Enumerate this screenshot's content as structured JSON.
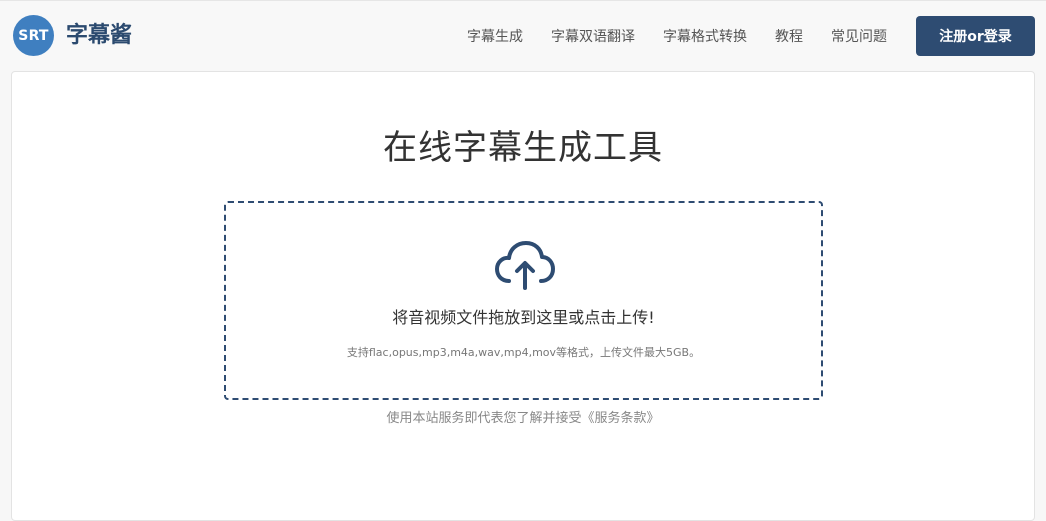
{
  "brand": {
    "logo_text": "SRT",
    "name": "字幕酱"
  },
  "nav": {
    "items": [
      {
        "label": "字幕生成"
      },
      {
        "label": "字幕双语翻译"
      },
      {
        "label": "字幕格式转换"
      },
      {
        "label": "教程"
      },
      {
        "label": "常见问题"
      }
    ],
    "login_label": "注册or登录"
  },
  "main": {
    "title": "在线字幕生成工具",
    "dropzone": {
      "icon": "cloud-upload-icon",
      "prompt": "将音视频文件拖放到这里或点击上传!",
      "formats": "支持flac,opus,mp3,m4a,wav,mp4,mov等格式，上传文件最大5GB。"
    },
    "terms": {
      "prefix": "使用本站服务即代表您了解并接受",
      "link": "《服务条款》"
    }
  },
  "colors": {
    "accent": "#2e4c72",
    "logo": "#3f7fc0"
  }
}
